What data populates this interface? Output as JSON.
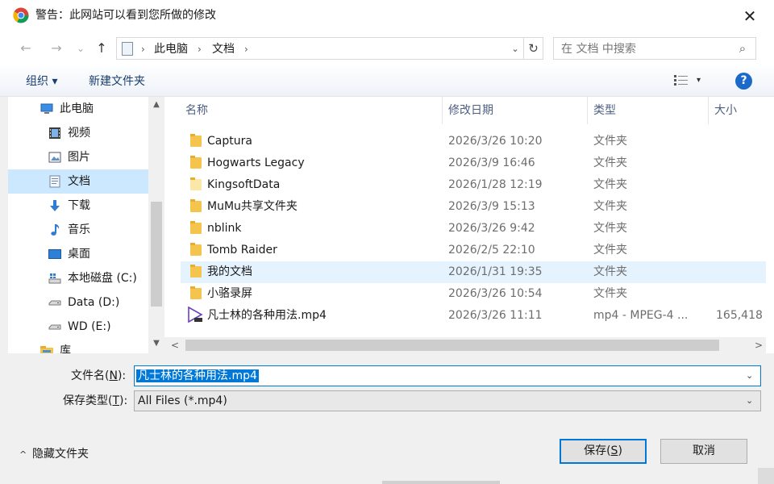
{
  "title_bar": {
    "title": "警告：此网站可以看到您所做的修改",
    "close_label": "✕"
  },
  "nav": {
    "back": "←",
    "forward": "→",
    "recent": "⌄",
    "up": "↑",
    "breadcrumb": [
      "此电脑",
      "文档"
    ],
    "separator": "›",
    "dropdown": "⌄",
    "refresh": "↻",
    "search_placeholder": "在 文档 中搜索",
    "search_icon": "⌕"
  },
  "toolbar": {
    "organize": "组织 ▾",
    "new_folder": "新建文件夹",
    "help": "?",
    "view_dropdown": "▾"
  },
  "sidebar": {
    "items": [
      {
        "label": "此电脑",
        "icon": "computer-icon"
      },
      {
        "label": "视频",
        "icon": "video-icon"
      },
      {
        "label": "图片",
        "icon": "pictures-icon"
      },
      {
        "label": "文档",
        "icon": "documents-icon",
        "selected": true
      },
      {
        "label": "下载",
        "icon": "download-icon"
      },
      {
        "label": "音乐",
        "icon": "music-icon"
      },
      {
        "label": "桌面",
        "icon": "desktop-icon"
      },
      {
        "label": "本地磁盘 (C:)",
        "icon": "drive-c-icon"
      },
      {
        "label": "Data (D:)",
        "icon": "drive-icon"
      },
      {
        "label": "WD (E:)",
        "icon": "drive-icon"
      },
      {
        "label": "库",
        "icon": "library-icon"
      }
    ],
    "scroll_up": "▲",
    "scroll_down": "▼"
  },
  "columns": {
    "name": "名称",
    "modified": "修改日期",
    "type": "类型",
    "size": "大小",
    "sort_arrow": "^"
  },
  "files": [
    {
      "name": "Captura",
      "modified": "2026/3/26 10:20",
      "type": "文件夹",
      "size": "",
      "kind": "folder"
    },
    {
      "name": "Hogwarts Legacy",
      "modified": "2026/3/9 16:46",
      "type": "文件夹",
      "size": "",
      "kind": "folder"
    },
    {
      "name": "KingsoftData",
      "modified": "2026/1/28 12:19",
      "type": "文件夹",
      "size": "",
      "kind": "folder"
    },
    {
      "name": "MuMu共享文件夹",
      "modified": "2026/3/9 15:13",
      "type": "文件夹",
      "size": "",
      "kind": "folder"
    },
    {
      "name": "nblink",
      "modified": "2026/3/26 9:42",
      "type": "文件夹",
      "size": "",
      "kind": "folder"
    },
    {
      "name": "Tomb Raider",
      "modified": "2026/2/5 22:10",
      "type": "文件夹",
      "size": "",
      "kind": "folder"
    },
    {
      "name": "我的文档",
      "modified": "2026/1/31 19:35",
      "type": "文件夹",
      "size": "",
      "kind": "folder",
      "hover": true
    },
    {
      "name": "小骆录屏",
      "modified": "2026/3/26 10:54",
      "type": "文件夹",
      "size": "",
      "kind": "folder"
    },
    {
      "name": "凡士林的各种用法.mp4",
      "modified": "2026/3/26 11:11",
      "type": "mp4 - MPEG-4 ...",
      "size": "165,418",
      "kind": "video"
    }
  ],
  "hscroll": {
    "left": "<",
    "right": ">"
  },
  "form": {
    "filename_label": "文件名(",
    "filename_key": "N",
    "filename_label_end": "):",
    "filename_value": "凡士林的各种用法.mp4",
    "filetype_label": "保存类型(",
    "filetype_key": "T",
    "filetype_label_end": "):",
    "filetype_value": "All Files (*.mp4)",
    "dropdown": "⌄"
  },
  "footer": {
    "hide_folders": "隐藏文件夹",
    "hide_chevron": "^",
    "save_label": "保存(",
    "save_key": "S",
    "save_end": ")",
    "cancel_label": "取消"
  },
  "colors": {
    "accent": "#0078d7",
    "selection": "#cce8ff",
    "hover": "#e5f3ff",
    "folder": "#f4c44d"
  }
}
